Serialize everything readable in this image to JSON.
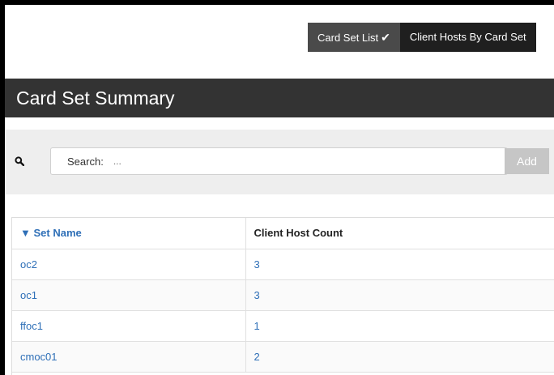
{
  "tabs": [
    {
      "label": "Card Set List",
      "active": true
    },
    {
      "label": "Client Hosts By Card Set",
      "active": false
    }
  ],
  "tab_check_icon": "✔",
  "page_title": "Card Set Summary",
  "search": {
    "icon": "search-icon",
    "label": "Search:",
    "placeholder": "...",
    "value": "",
    "add_label": "Add"
  },
  "table": {
    "sort_indicator": "▼",
    "columns": [
      "Set Name",
      "Client Host Count"
    ],
    "rows": [
      {
        "set_name": "oc2",
        "count": "3"
      },
      {
        "set_name": "oc1",
        "count": "3"
      },
      {
        "set_name": "ffoc1",
        "count": "1"
      },
      {
        "set_name": "cmoc01",
        "count": "2"
      }
    ]
  },
  "colors": {
    "title_bar": "#333333",
    "tab_active": "#4a4a4a",
    "tab_inactive": "#1f1f1f",
    "link": "#2e6fb7",
    "add_button": "#c6c6c6"
  }
}
